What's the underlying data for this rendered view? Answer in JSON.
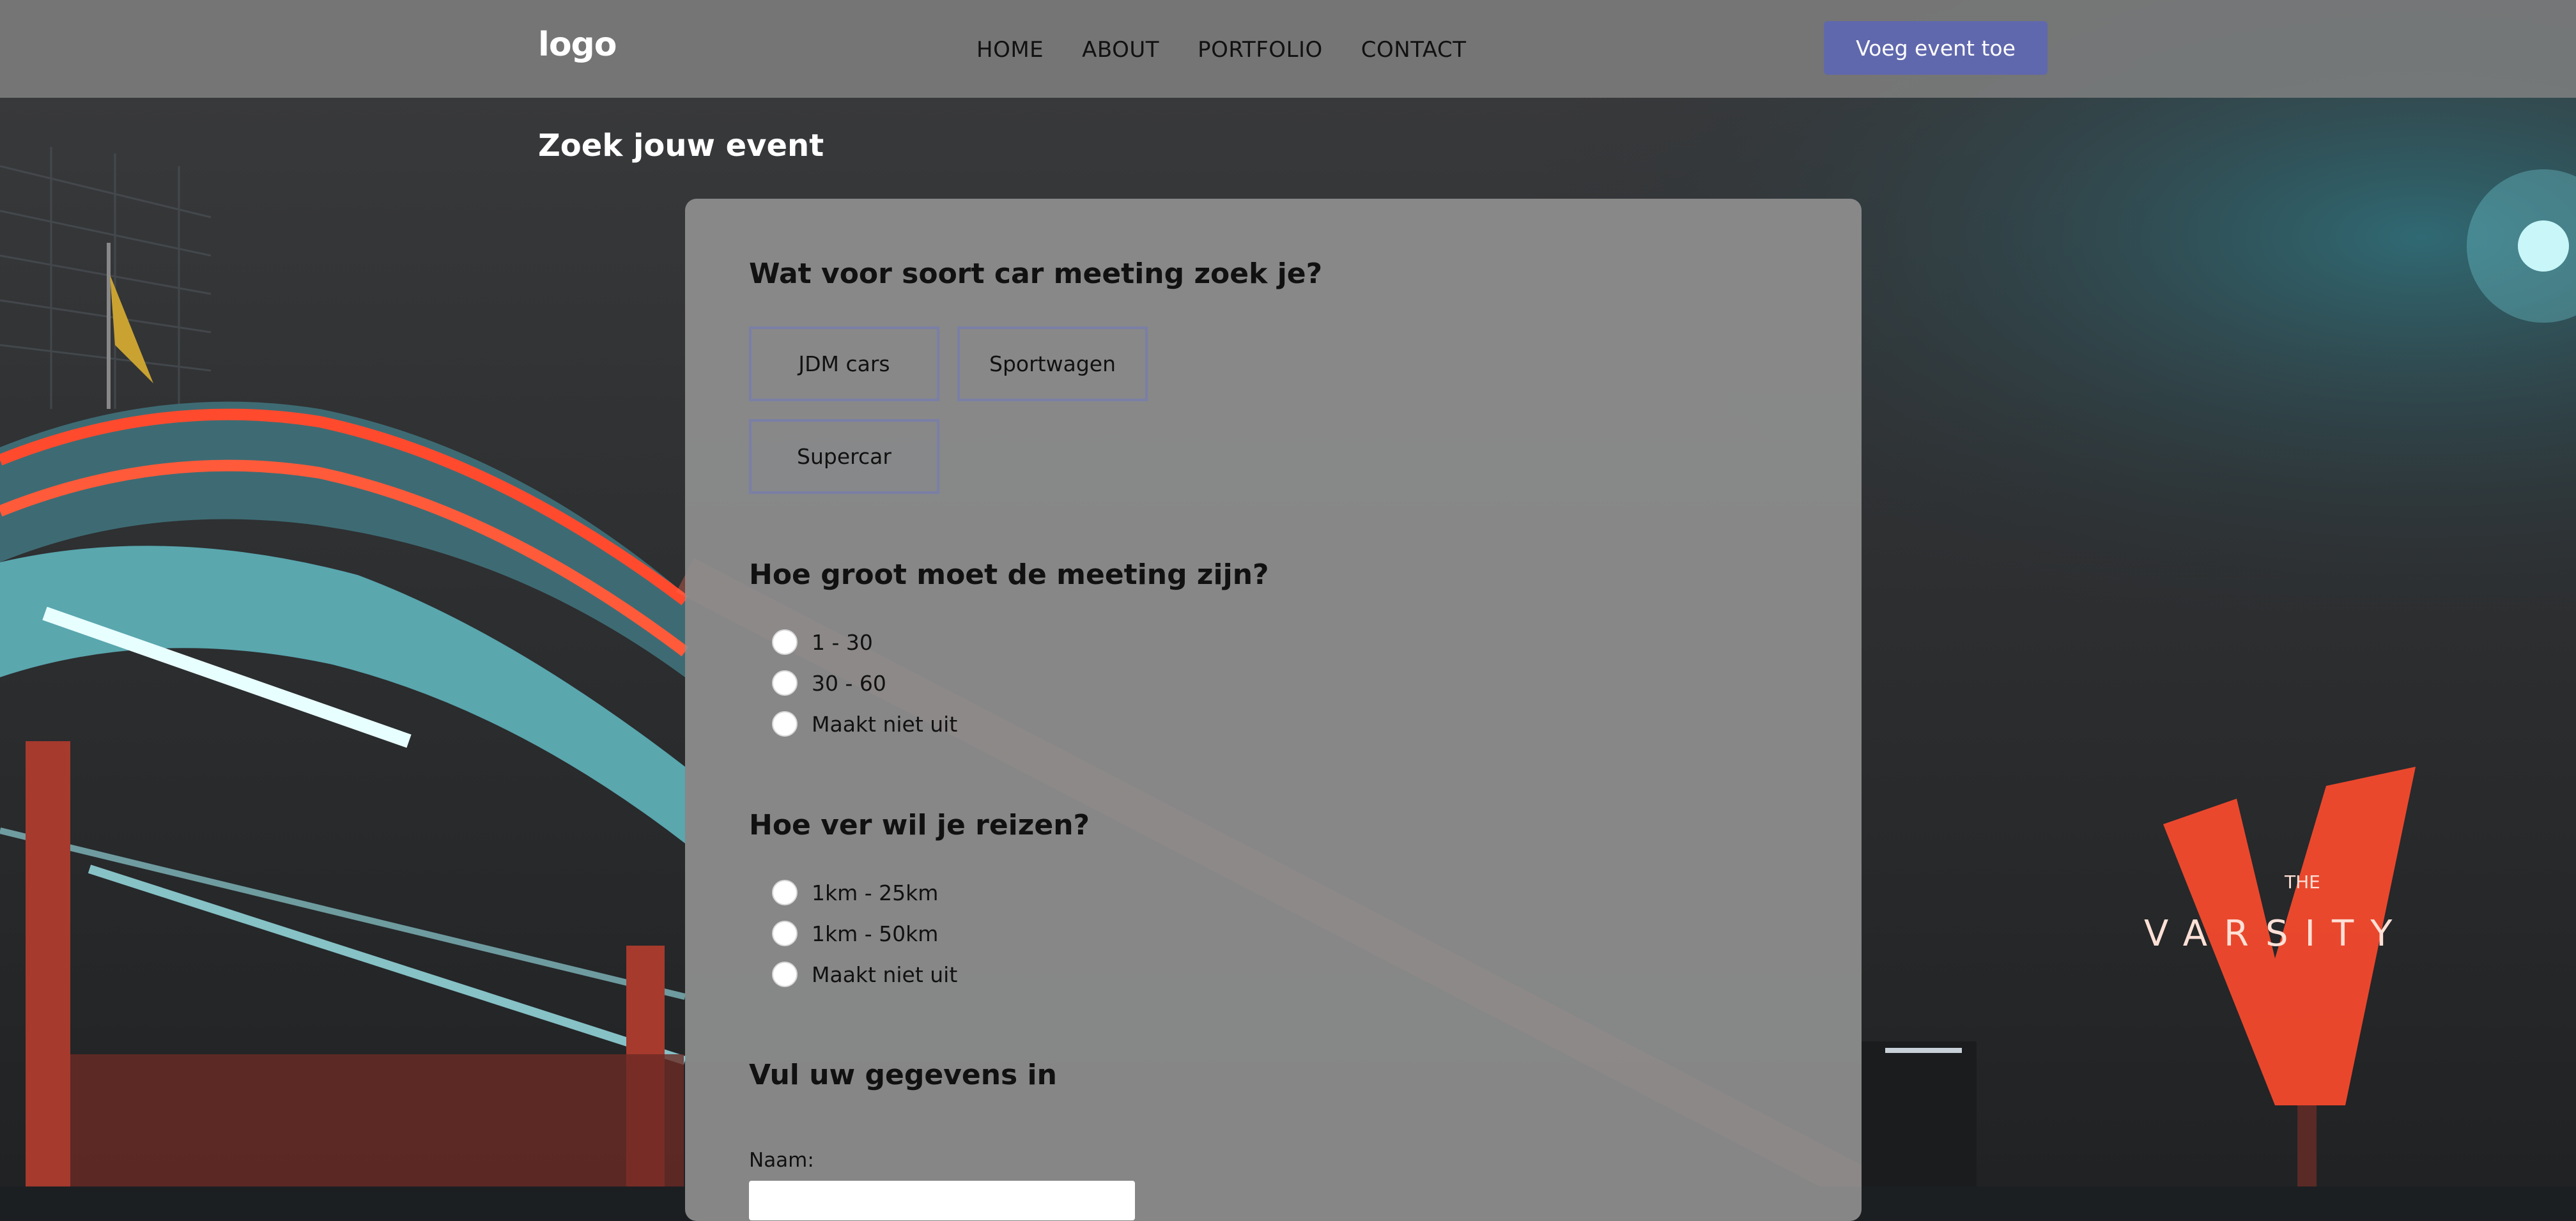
{
  "header": {
    "logo": "logo",
    "nav": [
      "HOME",
      "ABOUT",
      "PORTFOLIO",
      "CONTACT"
    ],
    "add_event_button": "Voeg event toe"
  },
  "page": {
    "title": "Zoek jouw event"
  },
  "form": {
    "q1": {
      "label": "Wat voor soort car meeting zoek je?",
      "options": [
        "JDM cars",
        "Sportwagen",
        "Supercar"
      ]
    },
    "q2": {
      "label": "Hoe groot moet de meeting zijn?",
      "options": [
        "1 - 30",
        "30 - 60",
        "Maakt niet uit"
      ]
    },
    "q3": {
      "label": "Hoe ver wil je reizen?",
      "options": [
        "1km - 25km",
        "1km - 50km",
        "Maakt niet uit"
      ]
    },
    "q4": {
      "label": "Vul uw gegevens in",
      "name_label": "Naam:"
    }
  },
  "colors": {
    "accent": "#6068ad",
    "header_bg": "#808080",
    "panel_bg": "#8f8f8f"
  }
}
